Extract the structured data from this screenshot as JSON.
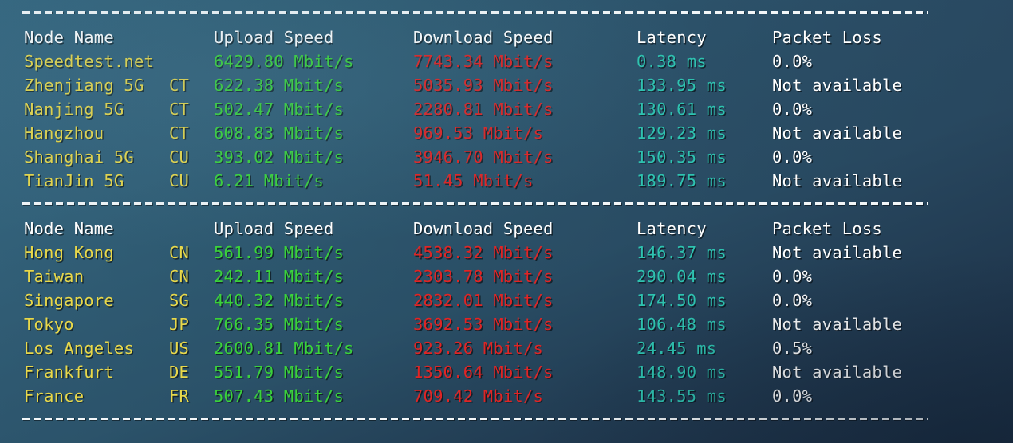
{
  "columns": {
    "node_name": "Node Name",
    "upload_speed": "Upload Speed",
    "download_speed": "Download Speed",
    "latency": "Latency",
    "packet_loss": "Packet Loss"
  },
  "colors": {
    "node_name": "#e8d84a",
    "country_code": "#e8d84a",
    "upload": "#3ad23a",
    "download": "#e02525",
    "latency": "#2ec3b0",
    "packet_loss": "#ffffff",
    "header": "#ffffff",
    "separator": "#f2f6f8",
    "background": "#2c5368"
  },
  "separators": {
    "top": "--------------------------------------------------------------------------------",
    "middle": "--------------------------------------------------------------------------------",
    "bottom": "--------------------------------------------------------------------------------"
  },
  "tables": [
    {
      "id": "domestic",
      "rows": [
        {
          "node_name": "Speedtest.net",
          "country_code": "",
          "upload_speed": "6429.80 Mbit/s",
          "download_speed": "7743.34 Mbit/s",
          "latency": "0.38 ms",
          "packet_loss": "0.0%"
        },
        {
          "node_name": "Zhenjiang 5G",
          "country_code": "CT",
          "upload_speed": "622.38 Mbit/s",
          "download_speed": "5035.93 Mbit/s",
          "latency": "133.95 ms",
          "packet_loss": "Not available"
        },
        {
          "node_name": "Nanjing 5G",
          "country_code": "CT",
          "upload_speed": "502.47 Mbit/s",
          "download_speed": "2280.81 Mbit/s",
          "latency": "130.61 ms",
          "packet_loss": "0.0%"
        },
        {
          "node_name": "Hangzhou",
          "country_code": "CT",
          "upload_speed": "608.83 Mbit/s",
          "download_speed": "969.53 Mbit/s",
          "latency": "129.23 ms",
          "packet_loss": "Not available"
        },
        {
          "node_name": "Shanghai 5G",
          "country_code": "CU",
          "upload_speed": "393.02 Mbit/s",
          "download_speed": "3946.70 Mbit/s",
          "latency": "150.35 ms",
          "packet_loss": "0.0%"
        },
        {
          "node_name": "TianJin 5G",
          "country_code": "CU",
          "upload_speed": "6.21 Mbit/s",
          "download_speed": "51.45 Mbit/s",
          "latency": "189.75 ms",
          "packet_loss": "Not available"
        }
      ]
    },
    {
      "id": "international",
      "rows": [
        {
          "node_name": "Hong Kong",
          "country_code": "CN",
          "upload_speed": "561.99 Mbit/s",
          "download_speed": "4538.32 Mbit/s",
          "latency": "146.37 ms",
          "packet_loss": "Not available"
        },
        {
          "node_name": "Taiwan",
          "country_code": "CN",
          "upload_speed": "242.11 Mbit/s",
          "download_speed": "2303.78 Mbit/s",
          "latency": "290.04 ms",
          "packet_loss": "0.0%"
        },
        {
          "node_name": "Singapore",
          "country_code": "SG",
          "upload_speed": "440.32 Mbit/s",
          "download_speed": "2832.01 Mbit/s",
          "latency": "174.50 ms",
          "packet_loss": "0.0%"
        },
        {
          "node_name": "Tokyo",
          "country_code": "JP",
          "upload_speed": "766.35 Mbit/s",
          "download_speed": "3692.53 Mbit/s",
          "latency": "106.48 ms",
          "packet_loss": "Not available"
        },
        {
          "node_name": "Los Angeles",
          "country_code": "US",
          "upload_speed": "2600.81 Mbit/s",
          "download_speed": "923.26 Mbit/s",
          "latency": "24.45 ms",
          "packet_loss": "0.5%"
        },
        {
          "node_name": "Frankfurt",
          "country_code": "DE",
          "upload_speed": "551.79 Mbit/s",
          "download_speed": "1350.64 Mbit/s",
          "latency": "148.90 ms",
          "packet_loss": "Not available"
        },
        {
          "node_name": "France",
          "country_code": "FR",
          "upload_speed": "507.43 Mbit/s",
          "download_speed": "709.42 Mbit/s",
          "latency": "143.55 ms",
          "packet_loss": "0.0%"
        }
      ]
    }
  ]
}
